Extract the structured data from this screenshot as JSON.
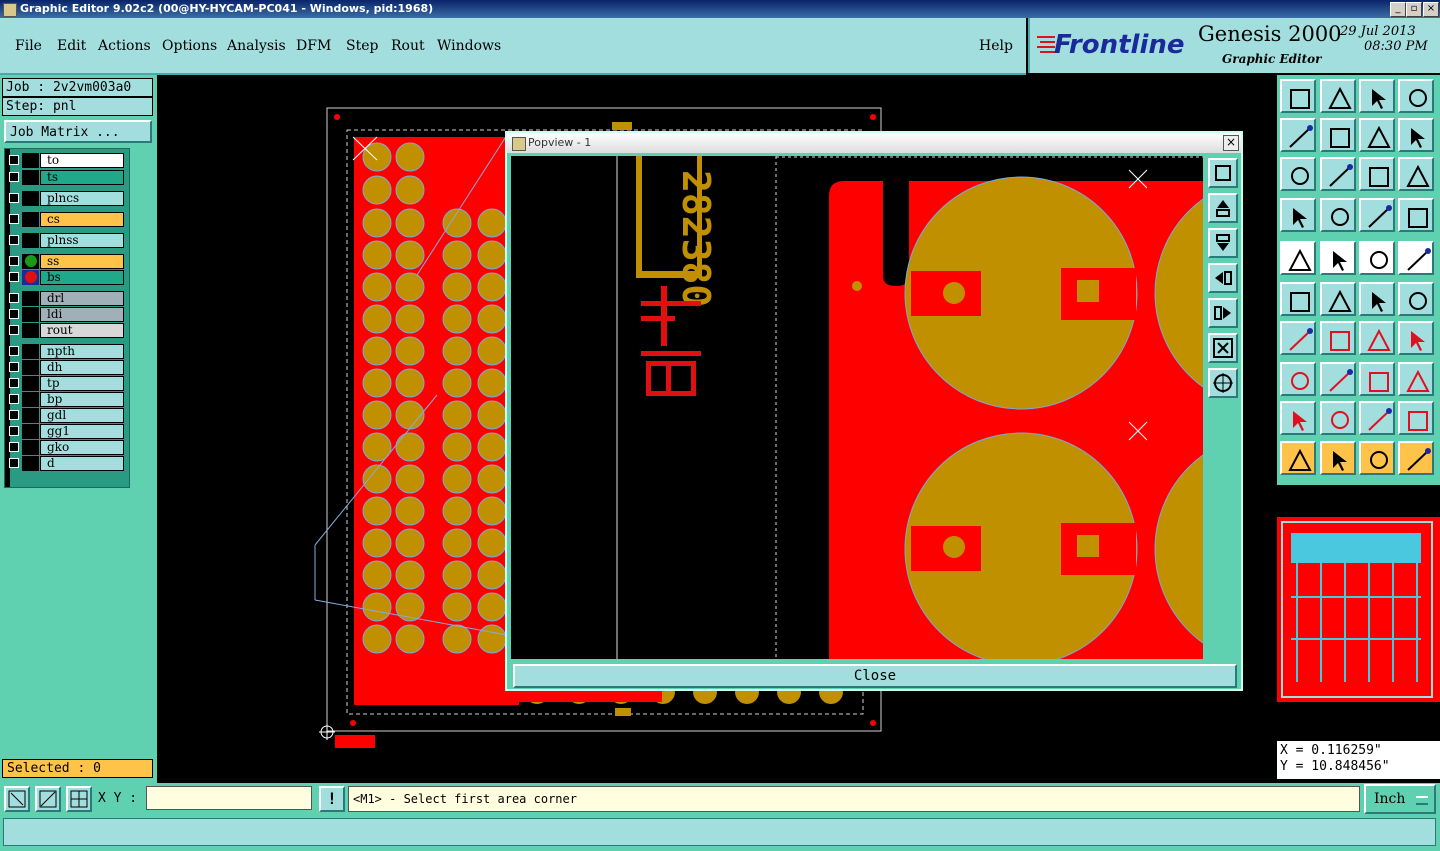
{
  "window": {
    "title": "Graphic Editor 9.02c2 (00@HY-HYCAM-PC041 - Windows, pid:1968)"
  },
  "menu": {
    "items": [
      "File",
      "Edit",
      "Actions",
      "Options",
      "Analysis",
      "DFM",
      "Step",
      "Rout",
      "Windows"
    ],
    "help": "Help"
  },
  "logo": {
    "brand": "Frontline",
    "product": "Genesis 2000",
    "subtitle": "Graphic Editor",
    "date": "29 Jul 2013",
    "time": "08:30 PM"
  },
  "job": {
    "job_label": "Job : 2v2vm003a0",
    "step_label": "Step: pnl",
    "matrix_button": "Job Matrix ..."
  },
  "layers": [
    {
      "name": "to",
      "color": "#ffffff"
    },
    {
      "name": "ts",
      "color": "#1fa88a"
    },
    {
      "name": "plncs",
      "color": "#a3dede"
    },
    {
      "name": "cs",
      "color": "#ffc34a"
    },
    {
      "name": "plnss",
      "color": "#a3dede"
    },
    {
      "name": "ss",
      "color": "#ffc34a"
    },
    {
      "name": "bs",
      "color": "#1fa88a"
    },
    {
      "name": "drl",
      "color": "#a0b0b8"
    },
    {
      "name": "ldi",
      "color": "#a0b0b8"
    },
    {
      "name": "rout",
      "color": "#d8d8d8"
    },
    {
      "name": "npth",
      "color": "#a3dede"
    },
    {
      "name": "dh",
      "color": "#a3dede"
    },
    {
      "name": "tp",
      "color": "#a3dede"
    },
    {
      "name": "bp",
      "color": "#a3dede"
    },
    {
      "name": "gdl",
      "color": "#a3dede"
    },
    {
      "name": "gg1",
      "color": "#a3dede"
    },
    {
      "name": "gko",
      "color": "#a3dede"
    },
    {
      "name": "d",
      "color": "#a3dede"
    }
  ],
  "selected": "Selected : 0",
  "popview": {
    "title": "Popview - 1",
    "close_label": "Close",
    "board_text": "282380"
  },
  "coords": {
    "x": "X = 0.116259\"",
    "y": "Y = 10.848456\""
  },
  "bottom": {
    "xy_label": "X Y :",
    "xy_value": "",
    "message": "<M1> - Select first area corner",
    "units": "Inch",
    "exclaim": "!"
  },
  "colors": {
    "copper": "#c09000",
    "board": "#ff0000",
    "panel": "#a3dede",
    "accent": "#5fd0b0"
  }
}
